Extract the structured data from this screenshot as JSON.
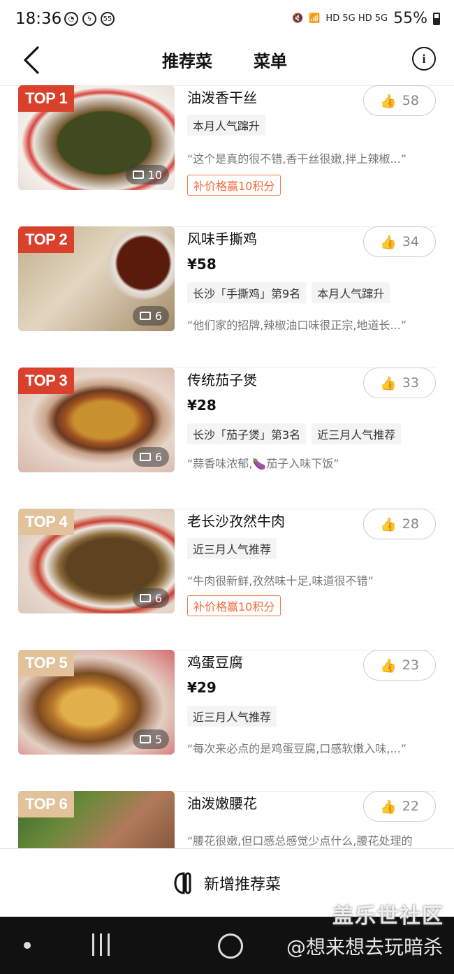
{
  "status_bar": {
    "time": "18:36",
    "badge": "55",
    "network": "HD 5G HD 5G",
    "battery": "55%"
  },
  "nav": {
    "tab_recommended": "推荐菜",
    "tab_menu": "菜单",
    "info_glyph": "i",
    "accent_color": "#ff6a3d"
  },
  "items": [
    {
      "rank": "TOP 1",
      "name": "油泼香干丝",
      "price": "",
      "tags": [
        "本月人气蹿升"
      ],
      "quote": "“这个是真的很不错,香干丝很嫩,拌上辣椒...”",
      "promo": "补价格赢10积分",
      "likes": "58",
      "photos": "10"
    },
    {
      "rank": "TOP 2",
      "name": "风味手撕鸡",
      "price": "¥58",
      "tags": [
        "长沙「手撕鸡」第9名",
        "本月人气蹿升"
      ],
      "quote": "“他们家的招牌,辣椒油口味很正宗,地道长...”",
      "promo": "",
      "likes": "34",
      "photos": "6"
    },
    {
      "rank": "TOP 3",
      "name": "传统茄子煲",
      "price": "¥28",
      "tags": [
        "长沙「茄子煲」第3名",
        "近三月人气推荐"
      ],
      "quote": "“蒜香味浓郁,🍆茄子入味下饭”",
      "promo": "",
      "likes": "33",
      "photos": "6"
    },
    {
      "rank": "TOP 4",
      "name": "老长沙孜然牛肉",
      "price": "",
      "tags": [
        "近三月人气推荐"
      ],
      "quote": "“牛肉很新鲜,孜然味十足,味道很不错”",
      "promo": "补价格赢10积分",
      "likes": "28",
      "photos": "6"
    },
    {
      "rank": "TOP 5",
      "name": "鸡蛋豆腐",
      "price": "¥29",
      "tags": [
        "近三月人气推荐"
      ],
      "quote": "“每次来必点的是鸡蛋豆腐,口感软嫩入味,...”",
      "promo": "",
      "likes": "23",
      "photos": "5"
    },
    {
      "rank": "TOP 6",
      "name": "油泼嫩腰花",
      "price": "",
      "tags": [],
      "quote": "“腰花很嫩,但口感总感觉少点什么,腰花处理的",
      "promo": "",
      "likes": "22",
      "photos": ""
    }
  ],
  "bottom": {
    "add_label": "新增推荐菜"
  },
  "watermark": {
    "site": "盖乐世社区",
    "user": "@想来想去玩暗杀"
  }
}
